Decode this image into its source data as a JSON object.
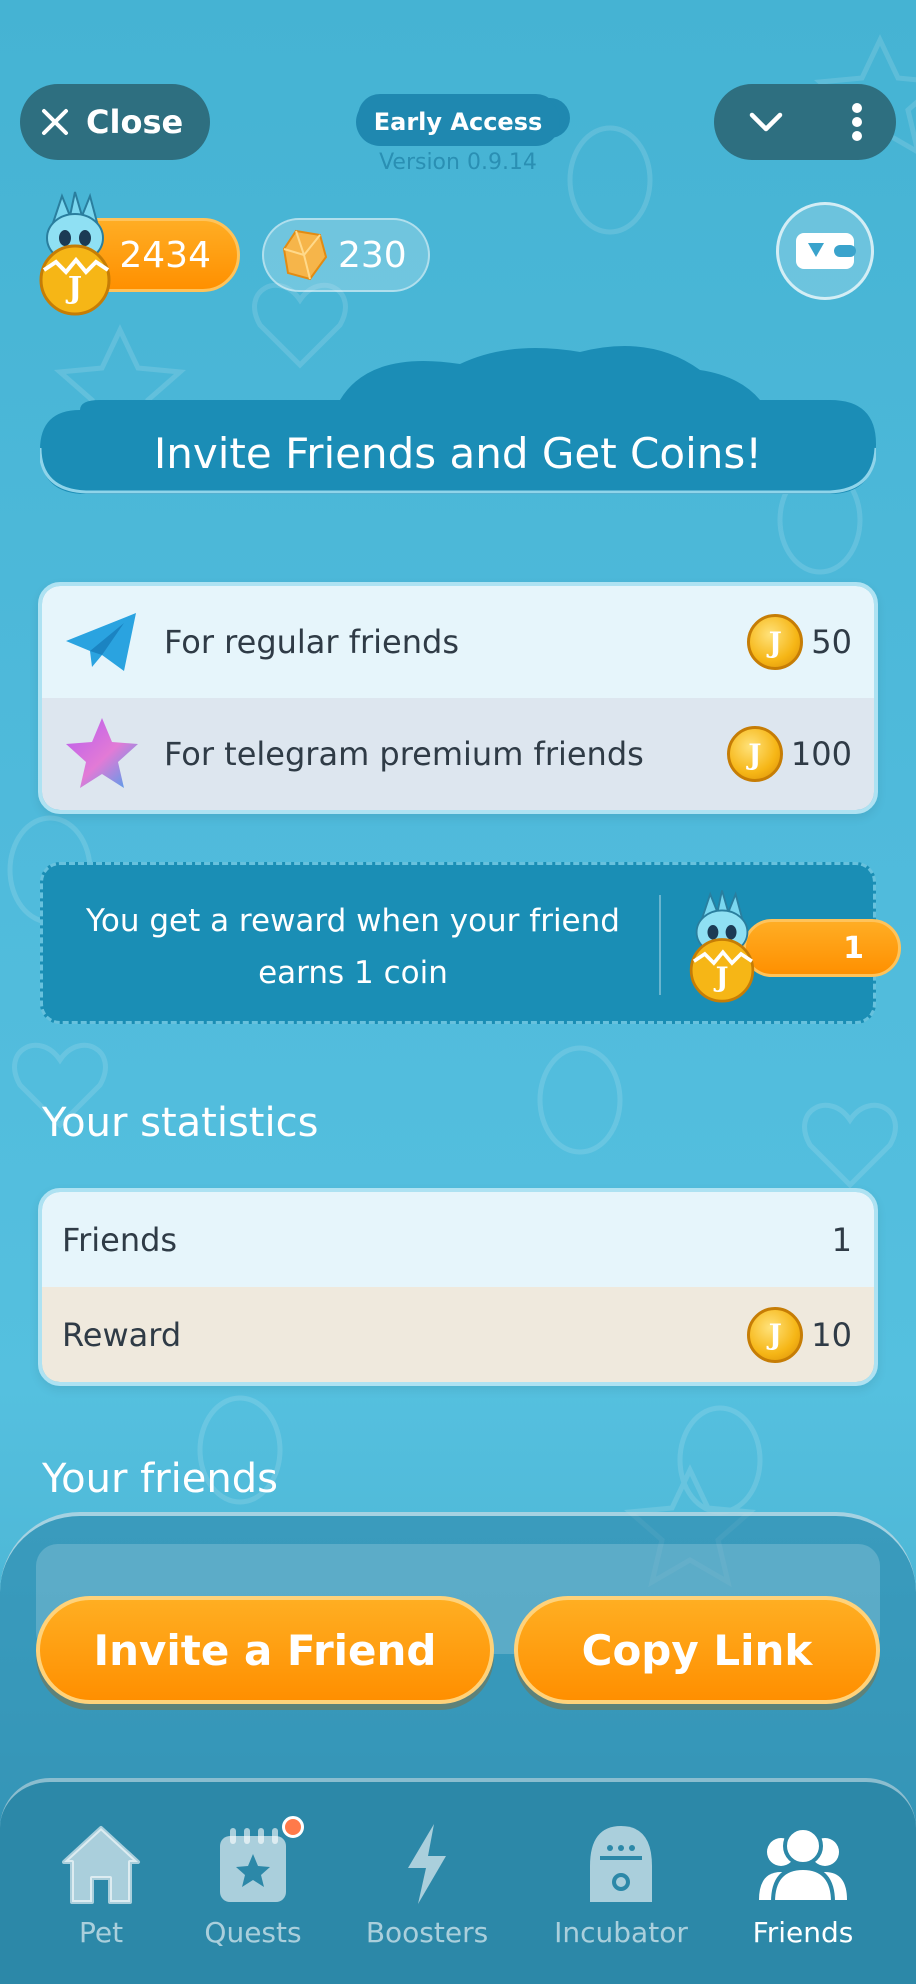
{
  "header": {
    "close_label": "Close",
    "early_access": "Early Access",
    "version": "Version 0.9.14"
  },
  "balance": {
    "coins": "2434",
    "crystals": "230"
  },
  "banner": {
    "title": "Invite Friends and Get Coins!"
  },
  "rewards": [
    {
      "label": "For regular friends",
      "value": "50",
      "icon": "telegram-plane-icon"
    },
    {
      "label": "For telegram premium friends",
      "value": "100",
      "icon": "premium-star-icon"
    }
  ],
  "earn": {
    "text": "You get a reward when your friend earns 1 coin",
    "value": "1"
  },
  "statistics": {
    "title": "Your statistics",
    "friends_label": "Friends",
    "friends_value": "1",
    "reward_label": "Reward",
    "reward_value": "10"
  },
  "friends_section": {
    "title": "Your friends"
  },
  "actions": {
    "invite_label": "Invite a Friend",
    "copy_label": "Copy Link"
  },
  "nav": [
    {
      "label": "Pet",
      "icon": "home-icon"
    },
    {
      "label": "Quests",
      "icon": "calendar-star-icon"
    },
    {
      "label": "Boosters",
      "icon": "lightning-icon"
    },
    {
      "label": "Incubator",
      "icon": "incubator-icon"
    },
    {
      "label": "Friends",
      "icon": "friends-icon"
    }
  ],
  "colors": {
    "background": "#4fbadb",
    "accent_orange": "#ff9a10",
    "panel_blue": "#1a8eb5"
  }
}
